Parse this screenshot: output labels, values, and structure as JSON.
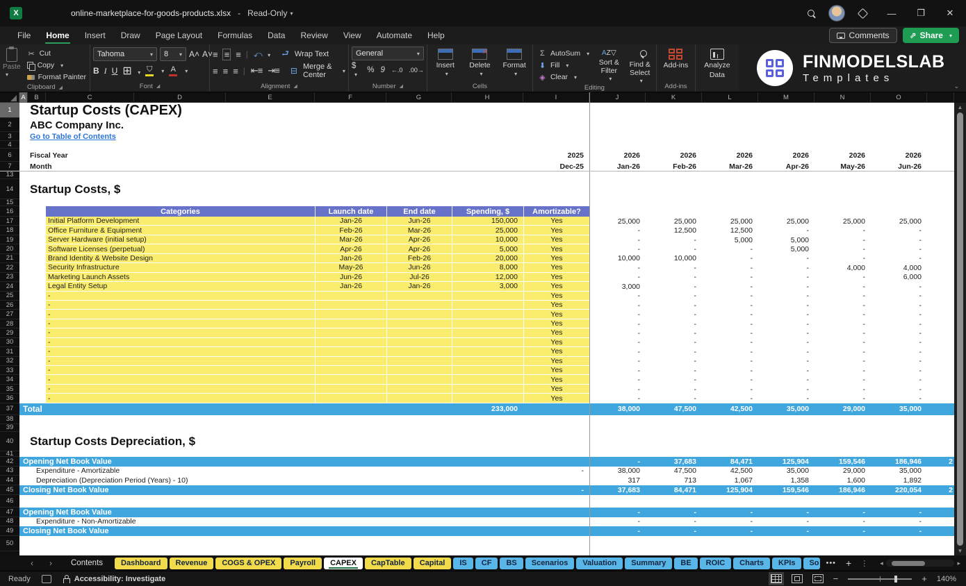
{
  "colors": {
    "header_purple": "#6673C9",
    "row_yellow": "#FAED6E",
    "total_blue": "#3FA7DE",
    "tab_yellow": "#F1DB4B",
    "tab_blue": "#58B7E8",
    "share_green": "#1E9C52",
    "link_blue": "#2E75D6"
  },
  "titlebar": {
    "filename": "online-marketplace-for-goods-products.xlsx",
    "separator": "-",
    "mode": "Read-Only"
  },
  "menu": {
    "items": [
      "File",
      "Home",
      "Insert",
      "Draw",
      "Page Layout",
      "Formulas",
      "Data",
      "Review",
      "View",
      "Automate",
      "Help"
    ],
    "active": "Home"
  },
  "top_buttons": {
    "comments": "Comments",
    "share": "Share"
  },
  "ribbon": {
    "clipboard": {
      "label": "Clipboard",
      "paste": "Paste",
      "cut": "Cut",
      "copy": "Copy",
      "format_painter": "Format Painter"
    },
    "font": {
      "label": "Font",
      "font_name": "Tahoma",
      "font_size": "8",
      "bold": "B",
      "italic": "I",
      "underline": "U"
    },
    "alignment": {
      "label": "Alignment",
      "wrap": "Wrap Text",
      "merge": "Merge & Center"
    },
    "number": {
      "label": "Number",
      "format": "General",
      "currency": "$",
      "percent": "%",
      "comma": "9"
    },
    "cells": {
      "label": "Cells",
      "insert": "Insert",
      "delete": "Delete",
      "format": "Format"
    },
    "editing": {
      "label": "Editing",
      "autosum": "AutoSum",
      "fill": "Fill",
      "clear": "Clear",
      "sort": "Sort & Filter",
      "find": "Find & Select"
    },
    "addins": {
      "label": "Add-ins",
      "addins": "Add-ins",
      "analyze_line1": "Analyze",
      "analyze_line2": "Data"
    }
  },
  "logo": {
    "line1": "FINMODELSLAB",
    "line2": "Templates"
  },
  "sheet": {
    "column_letters": [
      "A",
      "B",
      "C",
      "D",
      "E",
      "F",
      "G",
      "H",
      "I",
      "J",
      "K",
      "L",
      "M",
      "N",
      "O"
    ],
    "selected_column": "A",
    "selected_row": "1",
    "title": "Startup Costs (CAPEX)",
    "company": "ABC Company Inc.",
    "link": "Go to Table of Contents",
    "fiscal": {
      "label": "Fiscal Year",
      "dec": "2025",
      "months": [
        "2026",
        "2026",
        "2026",
        "2026",
        "2026",
        "2026"
      ]
    },
    "month": {
      "label": "Month",
      "dec": "Dec-25",
      "months": [
        "Jan-26",
        "Feb-26",
        "Mar-26",
        "Apr-26",
        "May-26",
        "Jun-26"
      ]
    },
    "capex_table": {
      "heading": "Startup Costs, $",
      "columns": [
        "Categories",
        "Launch date",
        "End date",
        "Spending, $",
        "Amortizable?"
      ],
      "rows": [
        {
          "category": "Initial Platform Development",
          "launch": "Jan-26",
          "end": "Jun-26",
          "spending": "150,000",
          "amortizable": "Yes",
          "months": [
            "25,000",
            "25,000",
            "25,000",
            "25,000",
            "25,000",
            "25,000"
          ]
        },
        {
          "category": "Office Furniture & Equipment",
          "launch": "Feb-26",
          "end": "Mar-26",
          "spending": "25,000",
          "amortizable": "Yes",
          "months": [
            "-",
            "12,500",
            "12,500",
            "-",
            "-",
            "-"
          ]
        },
        {
          "category": "Server Hardware (initial setup)",
          "launch": "Mar-26",
          "end": "Apr-26",
          "spending": "10,000",
          "amortizable": "Yes",
          "months": [
            "-",
            "-",
            "5,000",
            "5,000",
            "-",
            "-"
          ]
        },
        {
          "category": "Software Licenses (perpetual)",
          "launch": "Apr-26",
          "end": "Apr-26",
          "spending": "5,000",
          "amortizable": "Yes",
          "months": [
            "-",
            "-",
            "-",
            "5,000",
            "-",
            "-"
          ]
        },
        {
          "category": "Brand Identity & Website Design",
          "launch": "Jan-26",
          "end": "Feb-26",
          "spending": "20,000",
          "amortizable": "Yes",
          "months": [
            "10,000",
            "10,000",
            "-",
            "-",
            "-",
            "-"
          ]
        },
        {
          "category": "Security Infrastructure",
          "launch": "May-26",
          "end": "Jun-26",
          "spending": "8,000",
          "amortizable": "Yes",
          "months": [
            "-",
            "-",
            "-",
            "-",
            "4,000",
            "4,000"
          ]
        },
        {
          "category": "Marketing Launch Assets",
          "launch": "Jun-26",
          "end": "Jul-26",
          "spending": "12,000",
          "amortizable": "Yes",
          "months": [
            "-",
            "-",
            "-",
            "-",
            "-",
            "6,000"
          ]
        },
        {
          "category": "Legal Entity Setup",
          "launch": "Jan-26",
          "end": "Jan-26",
          "spending": "3,000",
          "amortizable": "Yes",
          "months": [
            "3,000",
            "-",
            "-",
            "-",
            "-",
            "-"
          ]
        }
      ],
      "empty_row_count": 12,
      "empty_row": {
        "category": "-",
        "launch": "",
        "end": "",
        "spending": "",
        "amortizable": "Yes",
        "months": [
          "-",
          "-",
          "-",
          "-",
          "-",
          "-"
        ]
      },
      "total": {
        "label": "Total",
        "spending": "233,000",
        "months": [
          "38,000",
          "47,500",
          "42,500",
          "35,000",
          "29,000",
          "35,000"
        ]
      }
    },
    "depreciation": {
      "heading": "Startup Costs Depreciation, $",
      "block1": [
        {
          "label": "Opening Net Book Value",
          "style": "banner",
          "dec": "",
          "months": [
            "-",
            "37,683",
            "84,471",
            "125,904",
            "159,546",
            "186,946"
          ],
          "partial": "2"
        },
        {
          "label": "Expenditure - Amortizable",
          "style": "plain",
          "dec": "-",
          "months": [
            "38,000",
            "47,500",
            "42,500",
            "35,000",
            "29,000",
            "35,000"
          ],
          "partial": ""
        },
        {
          "label": "Depreciation (Depreciation Period (Years) - 10)",
          "style": "plain",
          "dec": "",
          "months": [
            "317",
            "713",
            "1,067",
            "1,358",
            "1,600",
            "1,892"
          ],
          "partial": ""
        },
        {
          "label": "Closing Net Book Value",
          "style": "banner",
          "dec": "-",
          "months": [
            "37,683",
            "84,471",
            "125,904",
            "159,546",
            "186,946",
            "220,054"
          ],
          "partial": "2"
        }
      ],
      "block2": [
        {
          "label": "Opening Net Book Value",
          "style": "banner",
          "dec": "",
          "months": [
            "-",
            "-",
            "-",
            "-",
            "-",
            "-"
          ],
          "partial": ""
        },
        {
          "label": "Expenditure - Non-Amortizable",
          "style": "plain",
          "dec": "",
          "months": [
            "-",
            "-",
            "-",
            "-",
            "-",
            "-"
          ],
          "partial": ""
        },
        {
          "label": "Closing Net Book Value",
          "style": "banner",
          "dec": "",
          "months": [
            "-",
            "-",
            "-",
            "-",
            "-",
            "-"
          ],
          "partial": ""
        }
      ]
    }
  },
  "sheet_tabs": [
    {
      "label": "Contents",
      "kind": "plain"
    },
    {
      "label": "Dashboard",
      "kind": "yellow"
    },
    {
      "label": "Revenue",
      "kind": "yellow"
    },
    {
      "label": "COGS & OPEX",
      "kind": "yellow"
    },
    {
      "label": "Payroll",
      "kind": "yellow"
    },
    {
      "label": "CAPEX",
      "kind": "active"
    },
    {
      "label": "CapTable",
      "kind": "yellow"
    },
    {
      "label": "Capital",
      "kind": "yellow"
    },
    {
      "label": "IS",
      "kind": "blue"
    },
    {
      "label": "CF",
      "kind": "blue"
    },
    {
      "label": "BS",
      "kind": "blue"
    },
    {
      "label": "Scenarios",
      "kind": "blue"
    },
    {
      "label": "Valuation",
      "kind": "blue"
    },
    {
      "label": "Summary",
      "kind": "blue"
    },
    {
      "label": "BE",
      "kind": "blue"
    },
    {
      "label": "ROIC",
      "kind": "blue"
    },
    {
      "label": "Charts",
      "kind": "blue"
    },
    {
      "label": "KPIs",
      "kind": "blue"
    },
    {
      "label": "So",
      "kind": "blue-trunc"
    }
  ],
  "statusbar": {
    "ready": "Ready",
    "accessibility": "Accessibility: Investigate",
    "zoom": "140%"
  }
}
